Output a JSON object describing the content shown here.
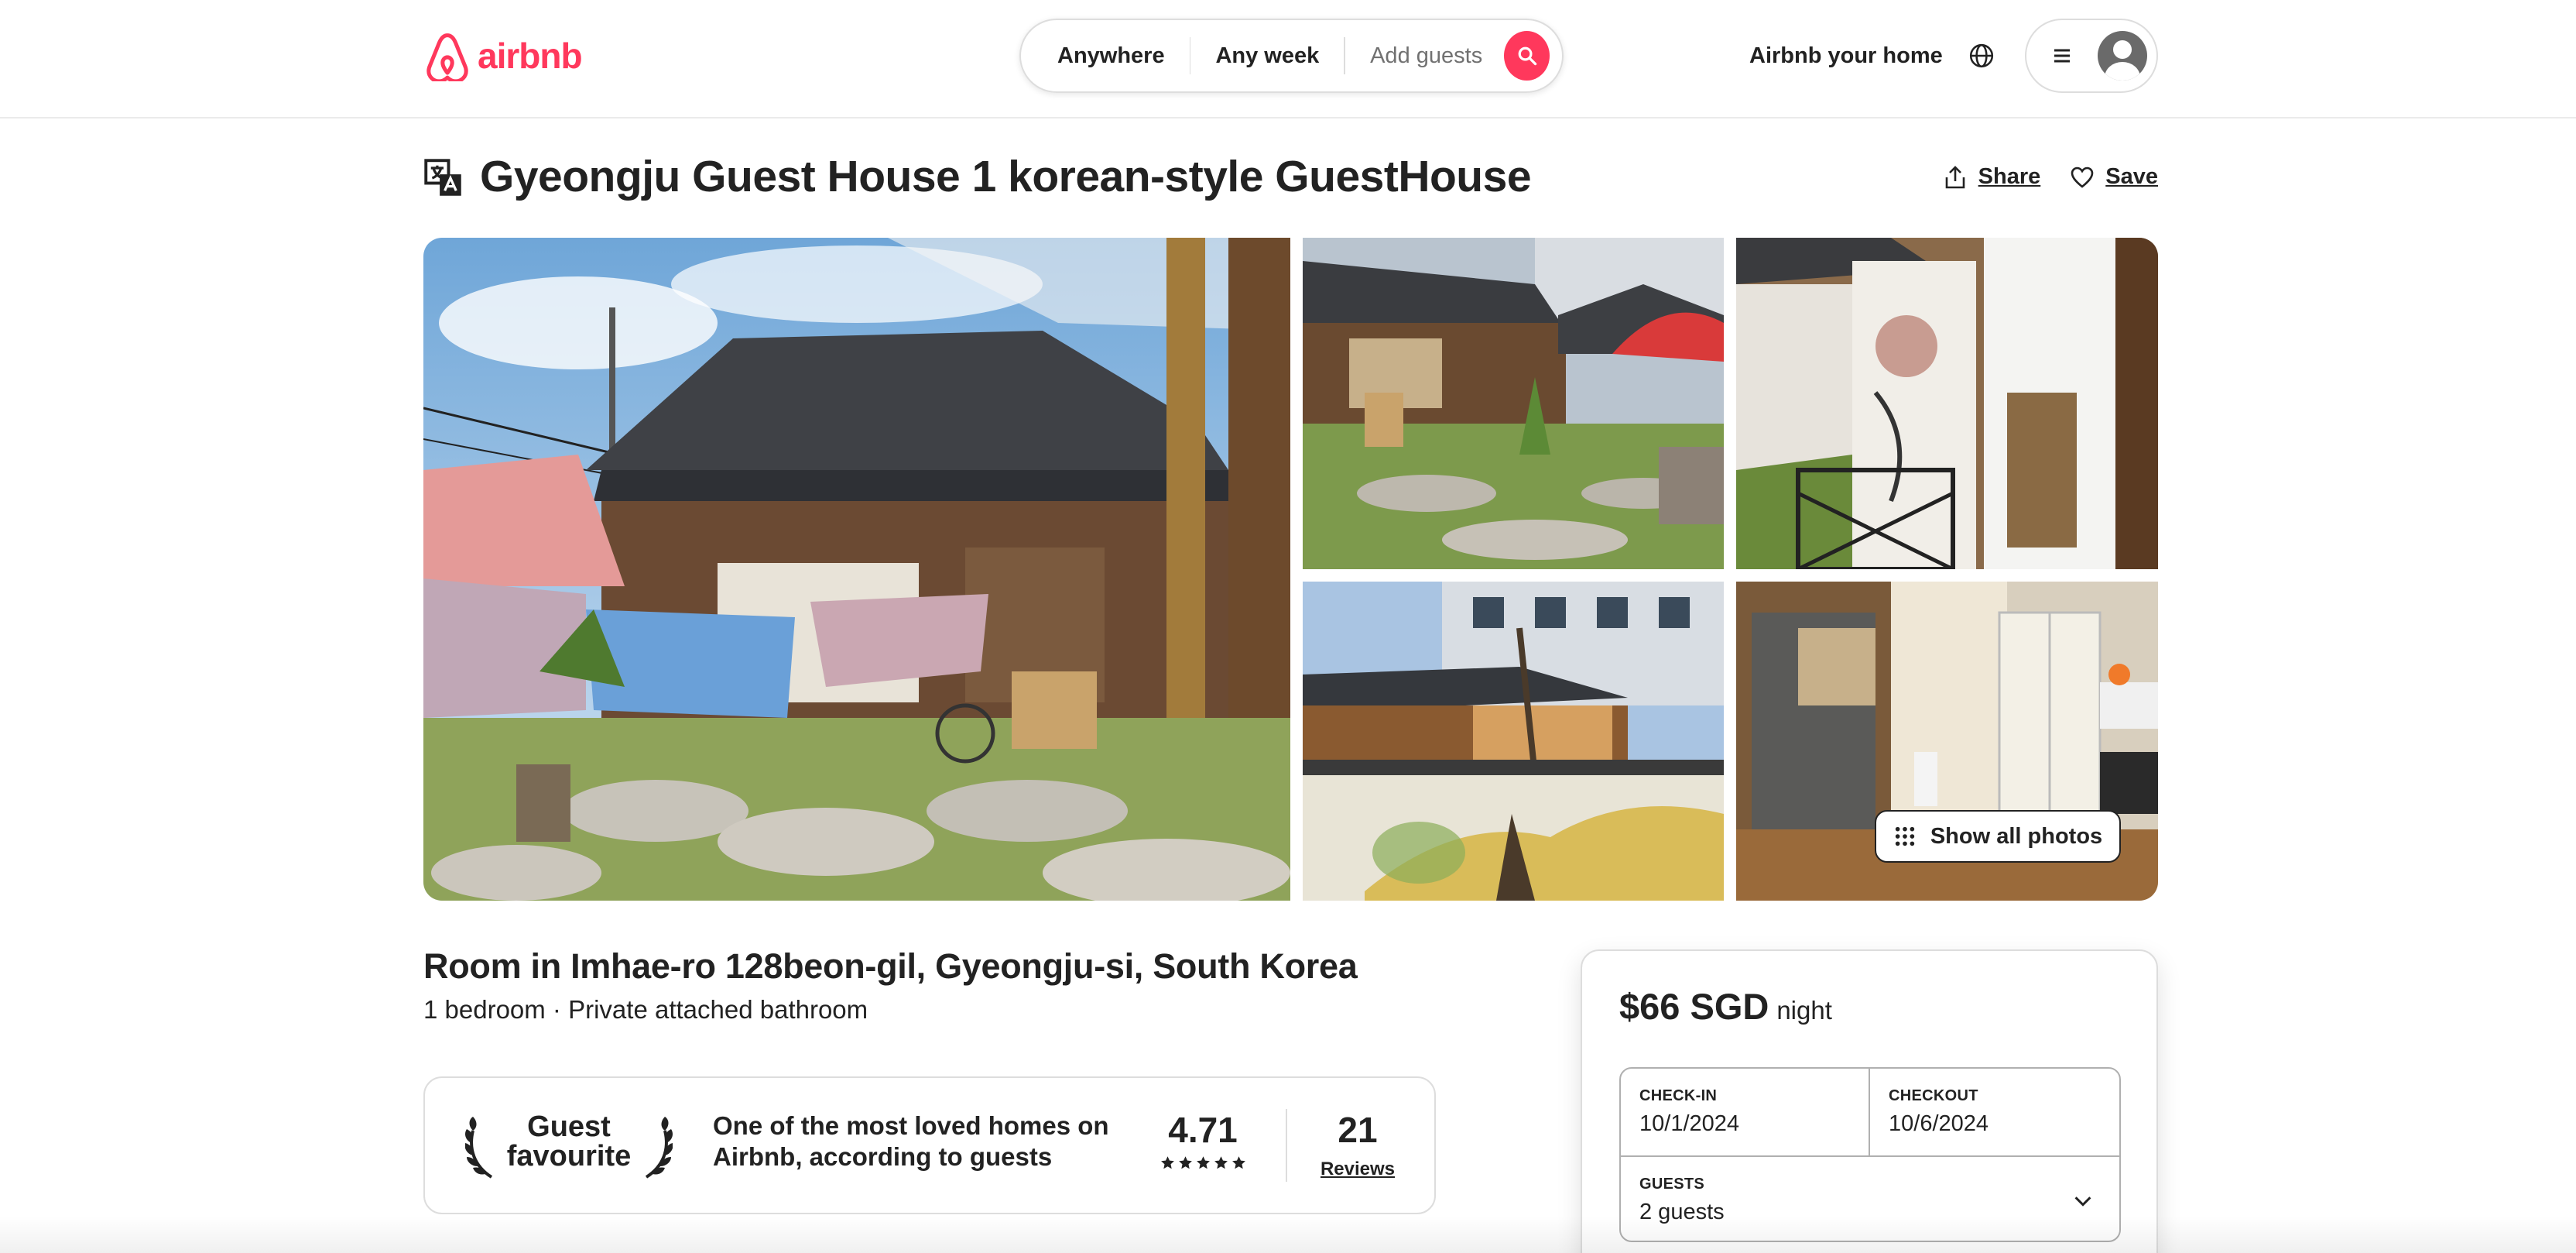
{
  "header": {
    "logo_text": "airbnb",
    "search": {
      "anywhere": "Anywhere",
      "any_week": "Any week",
      "add_guests": "Add guests"
    },
    "host_link": "Airbnb your home"
  },
  "listing": {
    "title": "Gyeongju Guest House 1 korean-style GuestHouse",
    "share_label": "Share",
    "save_label": "Save",
    "show_all_photos": "Show all photos",
    "room_title": "Room in Imhae-ro 128beon-gil, Gyeongju-si, South Korea",
    "room_details": "1 bedroom · Private attached bathroom"
  },
  "guest_favourite": {
    "label_line1": "Guest",
    "label_line2": "favourite",
    "description": "One of the most loved homes on Airbnb, according to guests",
    "rating": "4.71",
    "stars": 5,
    "reviews_count": "21",
    "reviews_label": "Reviews"
  },
  "booking": {
    "price": "$66 SGD",
    "price_unit": "night",
    "checkin_label": "CHECK-IN",
    "checkin_value": "10/1/2024",
    "checkout_label": "CHECKOUT",
    "checkout_value": "10/6/2024",
    "guests_label": "GUESTS",
    "guests_value": "2 guests"
  },
  "colors": {
    "brand": "#ff385c",
    "text": "#222222",
    "muted": "#717171",
    "border": "#dddddd"
  },
  "icons": [
    "airbnb-logo-icon",
    "search-icon",
    "globe-icon",
    "hamburger-menu-icon",
    "avatar-icon",
    "translate-icon",
    "share-icon",
    "heart-icon",
    "grid-icon",
    "laurel-icon",
    "star-icon",
    "chevron-down-icon"
  ]
}
